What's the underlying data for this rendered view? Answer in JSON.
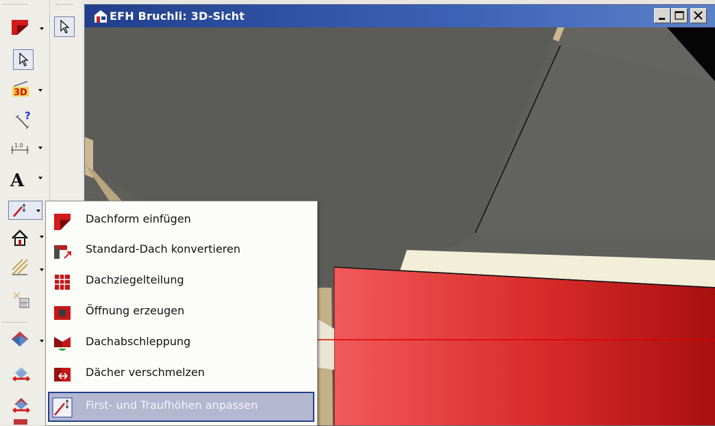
{
  "window": {
    "title": "EFH Bruchli: 3D-Sicht",
    "controls": [
      "minimize",
      "maximize",
      "close"
    ]
  },
  "toolbar_left": {
    "items": [
      "roof-tool",
      "pointer-select",
      "3d-view",
      "measure-help",
      "dimension",
      "text",
      "roof-height-tool",
      "house",
      "stair",
      "window-element",
      "roof-a",
      "roof-b",
      "roof-c"
    ]
  },
  "toolbar_secondary": {
    "items": [
      "pointer-select"
    ]
  },
  "dropdown_menu": {
    "items": [
      {
        "label": "Dachform einfügen",
        "icon": "roof-form-icon"
      },
      {
        "label": "Standard-Dach konvertieren",
        "icon": "roof-convert-icon"
      },
      {
        "label": "Dachziegelteilung",
        "icon": "roof-tiles-icon"
      },
      {
        "label": "Öffnung erzeugen",
        "icon": "roof-opening-icon"
      },
      {
        "label": "Dachabschleppung",
        "icon": "roof-drag-icon"
      },
      {
        "label": "Dächer verschmelzen",
        "icon": "roof-merge-icon"
      },
      {
        "label": "First- und Traufhöhen anpassen",
        "icon": "ridge-eave-height-icon",
        "highlighted": true
      }
    ]
  },
  "colors": {
    "title_bar": "#213e8c",
    "highlight": "#b3b7d0",
    "roof_red": "#e0302e",
    "annotation_arrow": "#e00000"
  }
}
